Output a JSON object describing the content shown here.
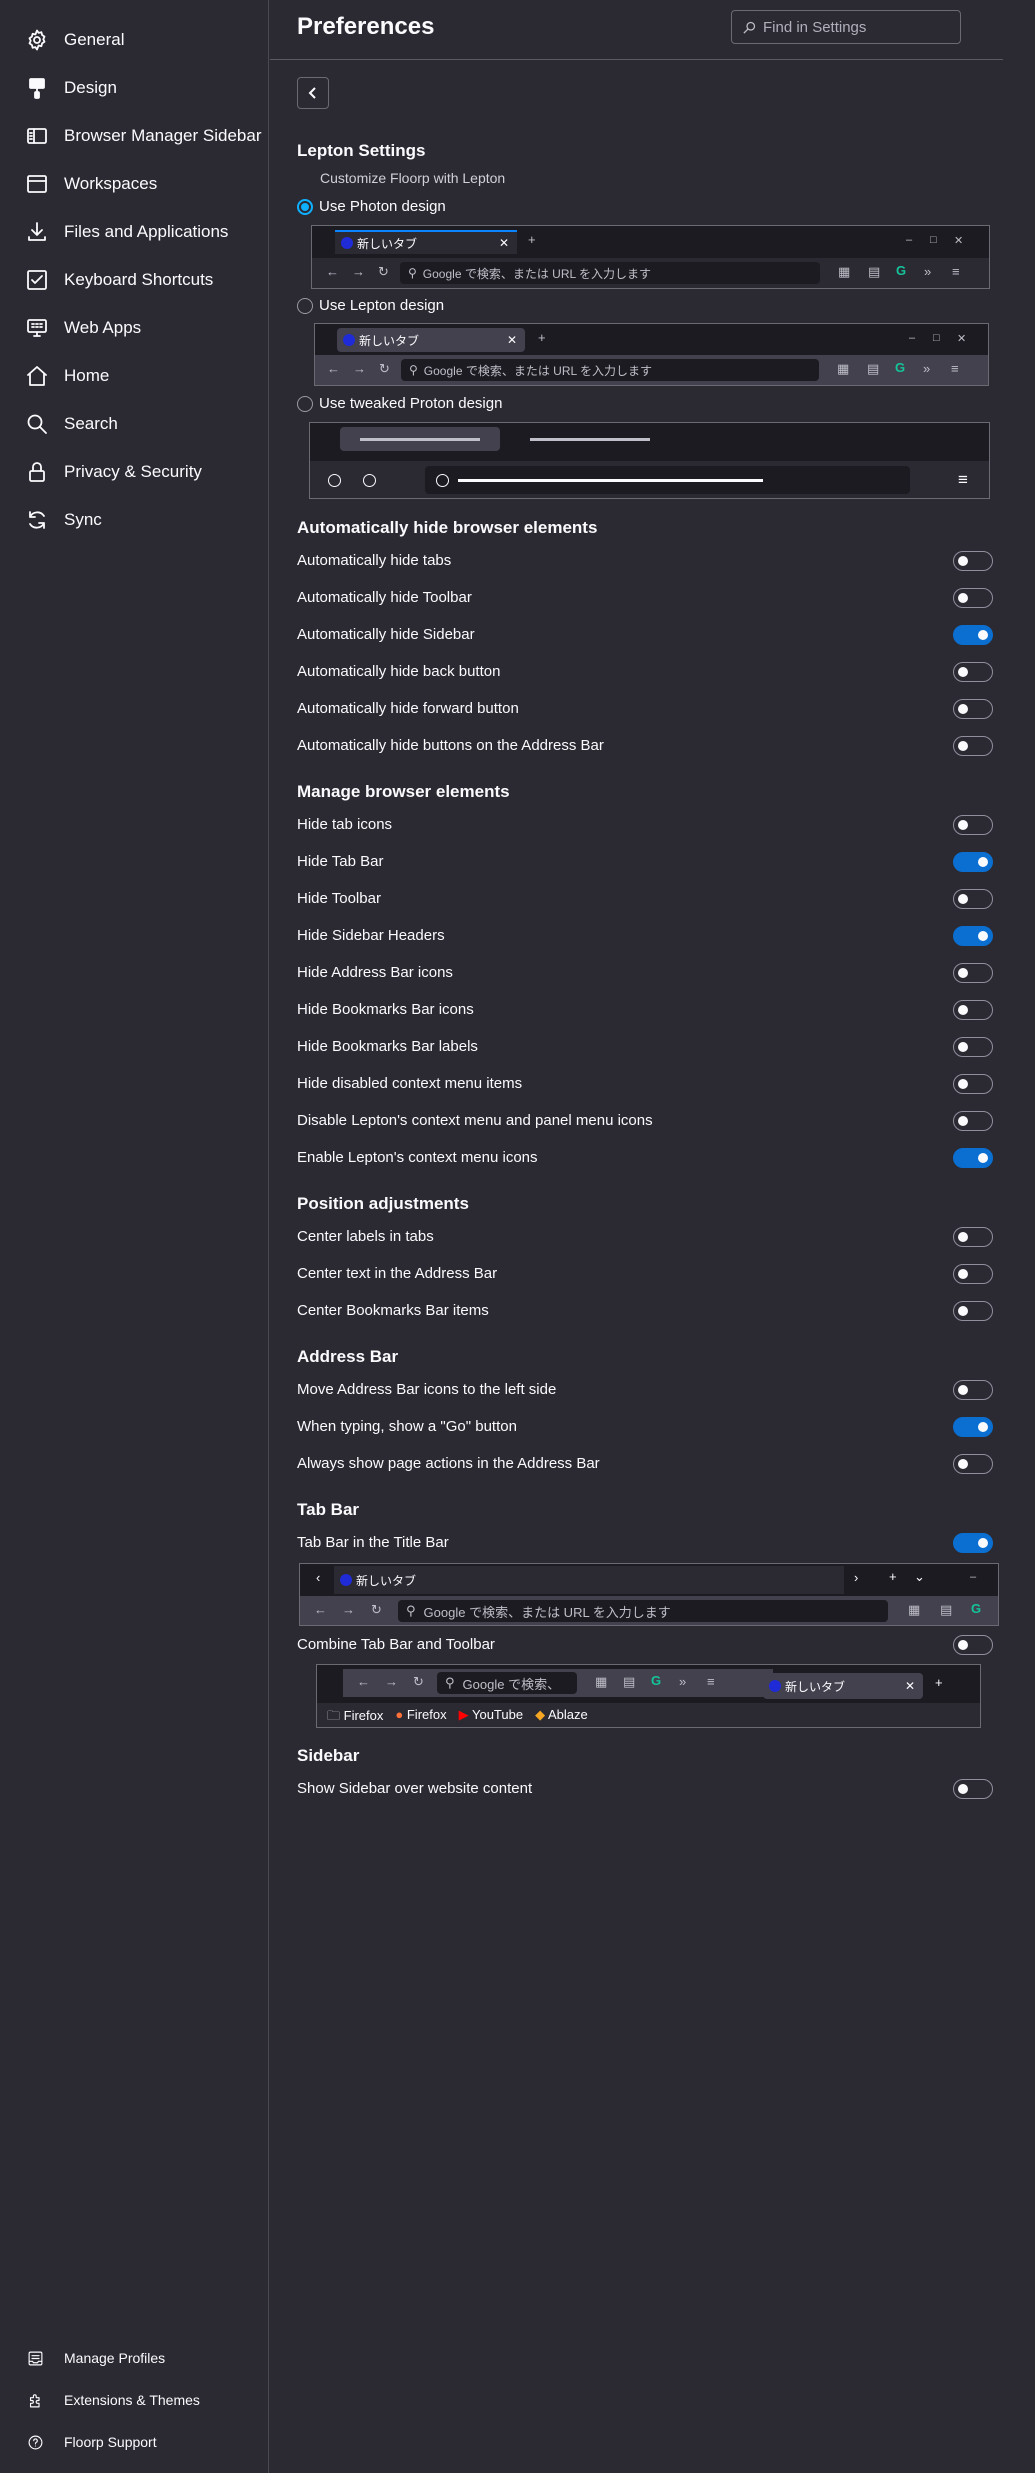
{
  "sidebar": {
    "items": [
      {
        "label": "General",
        "icon": "gear-icon"
      },
      {
        "label": "Design",
        "icon": "paintbrush-icon"
      },
      {
        "label": "Browser Manager Sidebar",
        "icon": "sidebar-icon"
      },
      {
        "label": "Workspaces",
        "icon": "window-icon"
      },
      {
        "label": "Files and Applications",
        "icon": "download-icon"
      },
      {
        "label": "Keyboard Shortcuts",
        "icon": "checkbox-icon"
      },
      {
        "label": "Web Apps",
        "icon": "monitor-icon"
      },
      {
        "label": "Home",
        "icon": "home-icon"
      },
      {
        "label": "Search",
        "icon": "search-icon"
      },
      {
        "label": "Privacy & Security",
        "icon": "lock-icon"
      },
      {
        "label": "Sync",
        "icon": "sync-icon"
      }
    ],
    "footer": [
      {
        "label": "Manage Profiles",
        "icon": "profiles-icon"
      },
      {
        "label": "Extensions & Themes",
        "icon": "puzzle-icon"
      },
      {
        "label": "Floorp Support",
        "icon": "help-icon"
      }
    ]
  },
  "header": {
    "title": "Preferences",
    "search_placeholder": "Find in Settings"
  },
  "lepton": {
    "title": "Lepton Settings",
    "subtitle": "Customize Floorp with Lepton",
    "options": [
      "Use Photon design",
      "Use Lepton design",
      "Use tweaked Proton design"
    ],
    "selected": 0
  },
  "preview": {
    "tab_title": "新しいタブ",
    "url_placeholder": "Google で検索、または URL を入力します",
    "url_placeholder_short": "Google で検索、",
    "bookmarks": [
      "Firefox",
      "Firefox",
      "YouTube",
      "Ablaze"
    ]
  },
  "sections": [
    {
      "title": "Automatically hide browser elements",
      "items": [
        {
          "label": "Automatically hide tabs",
          "on": false
        },
        {
          "label": "Automatically hide Toolbar",
          "on": false
        },
        {
          "label": "Automatically hide Sidebar",
          "on": true
        },
        {
          "label": "Automatically hide back button",
          "on": false
        },
        {
          "label": "Automatically hide forward button",
          "on": false
        },
        {
          "label": "Automatically hide buttons on the Address Bar",
          "on": false
        }
      ]
    },
    {
      "title": "Manage browser elements",
      "items": [
        {
          "label": "Hide tab icons",
          "on": false
        },
        {
          "label": "Hide Tab Bar",
          "on": true
        },
        {
          "label": "Hide Toolbar",
          "on": false
        },
        {
          "label": "Hide Sidebar Headers",
          "on": true
        },
        {
          "label": "Hide Address Bar icons",
          "on": false
        },
        {
          "label": "Hide Bookmarks Bar icons",
          "on": false
        },
        {
          "label": "Hide Bookmarks Bar labels",
          "on": false
        },
        {
          "label": "Hide disabled context menu items",
          "on": false
        },
        {
          "label": "Disable Lepton's context menu and panel menu icons",
          "on": false
        },
        {
          "label": "Enable Lepton's context menu icons",
          "on": true
        }
      ]
    },
    {
      "title": "Position adjustments",
      "items": [
        {
          "label": "Center labels in tabs",
          "on": false
        },
        {
          "label": "Center text in the Address Bar",
          "on": false
        },
        {
          "label": "Center Bookmarks Bar items",
          "on": false
        }
      ]
    },
    {
      "title": "Address Bar",
      "items": [
        {
          "label": "Move Address Bar icons to the left side",
          "on": false
        },
        {
          "label": "When typing, show a \"Go\" button",
          "on": true
        },
        {
          "label": "Always show page actions in the Address Bar",
          "on": false
        }
      ]
    },
    {
      "title": "Tab Bar",
      "items": [
        {
          "label": "Tab Bar in the Title Bar",
          "on": true
        },
        {
          "label": "Combine Tab Bar and Toolbar",
          "on": false
        }
      ]
    },
    {
      "title": "Sidebar",
      "items": [
        {
          "label": "Show Sidebar over website content",
          "on": false
        }
      ]
    }
  ],
  "colors": {
    "background": "#2b2a33",
    "accent": "#0a6fd1",
    "radio_accent": "#0fb0ff"
  }
}
